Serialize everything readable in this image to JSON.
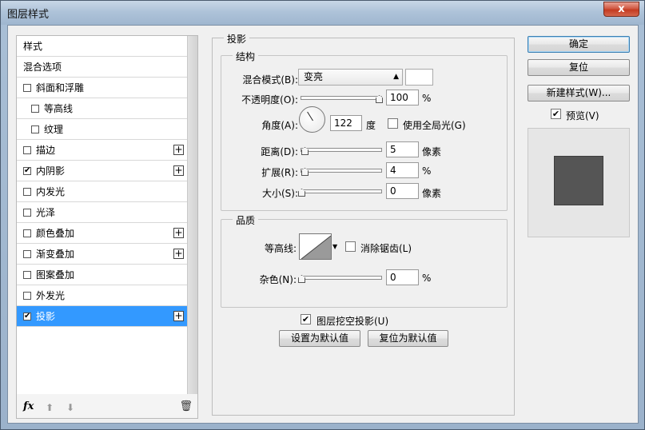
{
  "window": {
    "title": "图层样式",
    "close_label": "x"
  },
  "style_list": {
    "items": [
      {
        "label": "样式",
        "checkbox": false,
        "checked": false,
        "plus": false,
        "indent": false,
        "selected": false
      },
      {
        "label": "混合选项",
        "checkbox": false,
        "checked": false,
        "plus": false,
        "indent": false,
        "selected": false
      },
      {
        "label": "斜面和浮雕",
        "checkbox": true,
        "checked": false,
        "plus": false,
        "indent": false,
        "selected": false
      },
      {
        "label": "等高线",
        "checkbox": true,
        "checked": false,
        "plus": false,
        "indent": true,
        "selected": false
      },
      {
        "label": "纹理",
        "checkbox": true,
        "checked": false,
        "plus": false,
        "indent": true,
        "selected": false
      },
      {
        "label": "描边",
        "checkbox": true,
        "checked": false,
        "plus": true,
        "indent": false,
        "selected": false
      },
      {
        "label": "内阴影",
        "checkbox": true,
        "checked": true,
        "plus": true,
        "indent": false,
        "selected": false
      },
      {
        "label": "内发光",
        "checkbox": true,
        "checked": false,
        "plus": false,
        "indent": false,
        "selected": false
      },
      {
        "label": "光泽",
        "checkbox": true,
        "checked": false,
        "plus": false,
        "indent": false,
        "selected": false
      },
      {
        "label": "颜色叠加",
        "checkbox": true,
        "checked": false,
        "plus": true,
        "indent": false,
        "selected": false
      },
      {
        "label": "渐变叠加",
        "checkbox": true,
        "checked": false,
        "plus": true,
        "indent": false,
        "selected": false
      },
      {
        "label": "图案叠加",
        "checkbox": true,
        "checked": false,
        "plus": false,
        "indent": false,
        "selected": false
      },
      {
        "label": "外发光",
        "checkbox": true,
        "checked": false,
        "plus": false,
        "indent": false,
        "selected": false
      },
      {
        "label": "投影",
        "checkbox": true,
        "checked": true,
        "plus": true,
        "indent": false,
        "selected": true
      }
    ],
    "footer": {
      "fx_label": "fx",
      "up_icon": "arrow-up-icon",
      "down_icon": "arrow-down-icon",
      "trash_icon": "trash-icon"
    }
  },
  "panel": {
    "title": "投影",
    "structure": {
      "title": "结构",
      "blend_mode_label": "混合模式(B):",
      "blend_mode_value": "变亮",
      "shadow_color": "#ffffff",
      "opacity_label": "不透明度(O):",
      "opacity_value": "100",
      "opacity_unit": "%",
      "opacity_level": 1.0,
      "angle_label": "角度(A):",
      "angle_value": "122",
      "angle_unit": "度",
      "global_light_label": "使用全局光(G)",
      "global_light_checked": false,
      "distance_label": "距离(D):",
      "distance_value": "5",
      "distance_unit": "像素",
      "spread_label": "扩展(R):",
      "spread_value": "4",
      "spread_unit": "%",
      "size_label": "大小(S):",
      "size_value": "0",
      "size_unit": "像素"
    },
    "quality": {
      "title": "品质",
      "contour_label": "等高线:",
      "anti_alias_label": "消除锯齿(L)",
      "anti_alias_checked": false,
      "noise_label": "杂色(N):",
      "noise_value": "0",
      "noise_unit": "%"
    },
    "knockout_label": "图层挖空投影(U)",
    "knockout_checked": true,
    "make_default_label": "设置为默认值",
    "reset_default_label": "复位为默认值"
  },
  "buttons": {
    "ok": "确定",
    "reset": "复位",
    "new_style": "新建样式(W)...",
    "preview_label": "预览(V)",
    "preview_checked": true
  },
  "preview": {
    "swatch_color": "#555555"
  }
}
